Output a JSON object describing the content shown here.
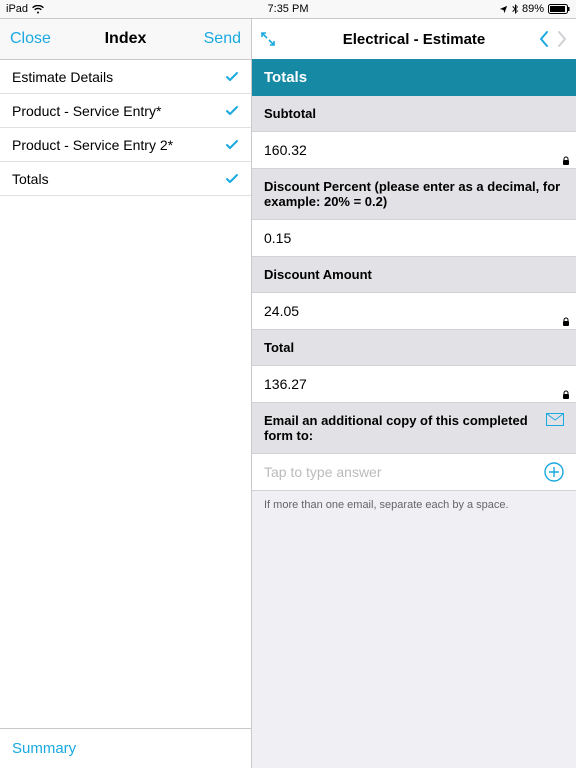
{
  "statusbar": {
    "device": "iPad",
    "time": "7:35 PM",
    "battery": "89%"
  },
  "leftpane": {
    "close": "Close",
    "title": "Index",
    "send": "Send",
    "items": [
      {
        "label": "Estimate Details"
      },
      {
        "label": "Product - Service Entry*"
      },
      {
        "label": "Product - Service Entry 2*"
      },
      {
        "label": "Totals"
      }
    ],
    "footer": "Summary"
  },
  "rightpane": {
    "title": "Electrical - Estimate",
    "section": "Totals",
    "rows": {
      "subtotal_label": "Subtotal",
      "subtotal_value": "160.32",
      "discount_pct_label": "Discount Percent (please enter as a decimal, for example: 20% = 0.2)",
      "discount_pct_value": "0.15",
      "discount_amt_label": "Discount Amount",
      "discount_amt_value": "24.05",
      "total_label": "Total",
      "total_value": "136.27",
      "email_label": "Email an additional copy of this completed form to:",
      "email_placeholder": "Tap to type answer",
      "email_hint": "If more than one email, separate each by a space."
    }
  }
}
